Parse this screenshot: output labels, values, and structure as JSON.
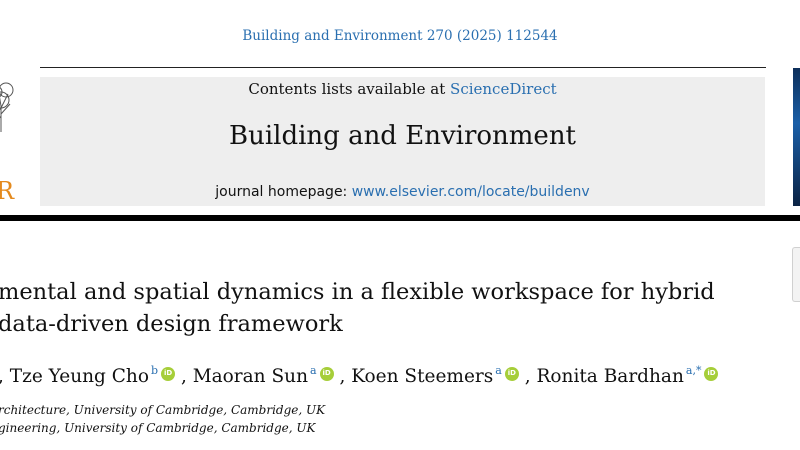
{
  "citation": "Building and Environment 270 (2025) 112544",
  "header": {
    "publisher_wordmark_fragment": "R",
    "contents_prefix": "Contents lists available at ",
    "contents_link": "ScienceDirect",
    "journal_title": "Building and Environment",
    "homepage_prefix": "journal homepage: ",
    "homepage_link": "www.elsevier.com/locate/buildenv"
  },
  "article": {
    "title_line_1": "mental and spatial dynamics in a flexible workspace for hybrid",
    "title_line_2": "data-driven design framework"
  },
  "authors": [
    {
      "name": ", Tze Yeung Cho",
      "sup": "b"
    },
    {
      "name": ", Maoran Sun",
      "sup": "a"
    },
    {
      "name": ", Koen Steemers",
      "sup": "a"
    },
    {
      "name": ", Ronita Bardhan",
      "sup": "a,*"
    }
  ],
  "orcid_label": "iD",
  "affiliations": [
    "rchitecture, University of Cambridge, Cambridge, UK",
    "gineering, University of Cambridge, Cambridge, UK"
  ],
  "colors": {
    "link": "#2a6fb0",
    "journal_box_bg": "#eeeeee",
    "elsevier_orange": "#e48a1e",
    "orcid_green": "#a6ce39"
  },
  "icons": [
    "elsevier-tree-logo",
    "orcid-icon",
    "journal-cover-thumbnail",
    "crossmark-icon"
  ]
}
